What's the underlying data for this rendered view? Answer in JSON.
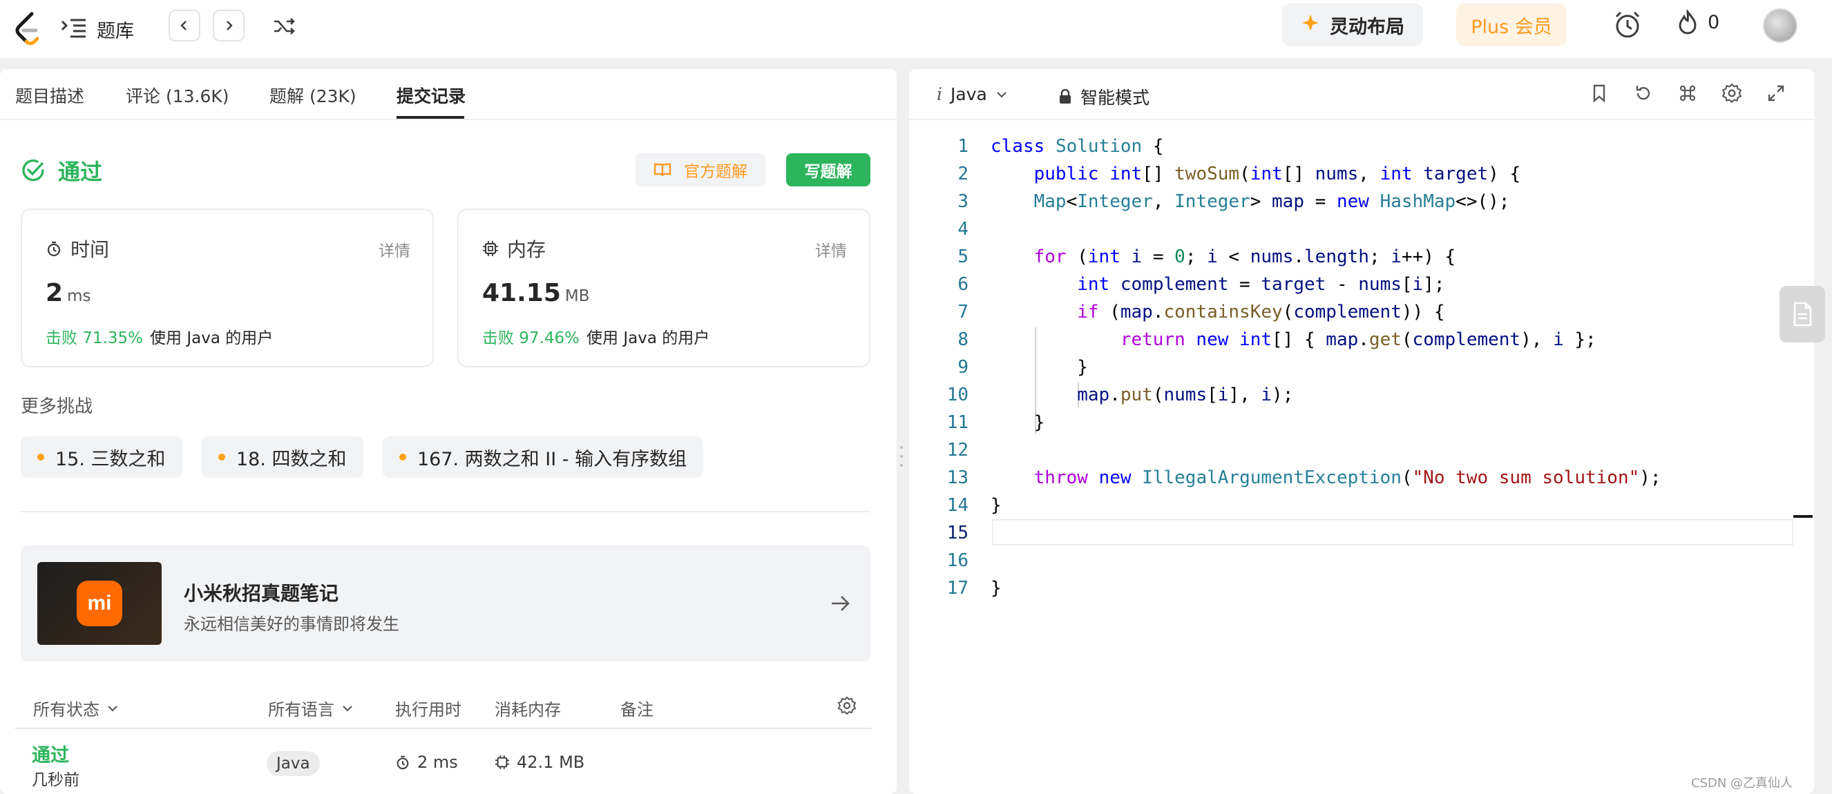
{
  "nav": {
    "title": "题库",
    "layout_button": "灵动布局",
    "plus_button": "Plus 会员",
    "streak_count": "0"
  },
  "tabs": [
    {
      "label": "题目描述"
    },
    {
      "label": "评论 (13.6K)"
    },
    {
      "label": "题解 (23K)"
    },
    {
      "label": "提交记录"
    }
  ],
  "result": {
    "status": "通过",
    "official_solution": "官方题解",
    "write_solution": "写题解",
    "time_card": {
      "title": "时间",
      "detail": "详情",
      "value": "2",
      "unit": "ms",
      "beat": "击败 71.35%",
      "beat_suffix": "使用 Java 的用户"
    },
    "memory_card": {
      "title": "内存",
      "detail": "详情",
      "value": "41.15",
      "unit": "MB",
      "beat": "击败 97.46%",
      "beat_suffix": "使用 Java 的用户"
    }
  },
  "more": {
    "title": "更多挑战",
    "items": [
      "15. 三数之和",
      "18. 四数之和",
      "167. 两数之和 II - 输入有序数组"
    ]
  },
  "promo": {
    "logo_text": "mi",
    "title": "小米秋招真题笔记",
    "subtitle": "永远相信美好的事情即将发生"
  },
  "table": {
    "headers": {
      "status": "所有状态",
      "lang": "所有语言",
      "runtime": "执行用时",
      "memory": "消耗内存",
      "note": "备注"
    },
    "rows": [
      {
        "status": "通过",
        "time": "几秒前",
        "lang": "Java",
        "runtime": "2 ms",
        "memory": "42.1 MB"
      }
    ]
  },
  "editor": {
    "language": "Java",
    "mode": "智能模式",
    "line_numbers": [
      "1",
      "2",
      "3",
      "4",
      "5",
      "6",
      "7",
      "8",
      "9",
      "10",
      "11",
      "12",
      "13",
      "14",
      "15",
      "16",
      "17"
    ],
    "code_lines": [
      "class Solution {",
      "    public int[] twoSum(int[] nums, int target) {",
      "    Map<Integer, Integer> map = new HashMap<>();",
      "",
      "    for (int i = 0; i < nums.length; i++) {",
      "        int complement = target - nums[i];",
      "        if (map.containsKey(complement)) {",
      "            return new int[] { map.get(complement), i };",
      "        }",
      "        map.put(nums[i], i);",
      "    }",
      "",
      "    throw new IllegalArgumentException(\"No two sum solution\");",
      "}",
      "",
      "",
      "}"
    ]
  },
  "watermark": "CSDN @乙真仙人",
  "colors": {
    "success": "#2db55d",
    "orange": "#ff9a1f",
    "keyword": "#0000ff",
    "control_keyword": "#af00db",
    "type": "#267f99",
    "function": "#795e26",
    "variable": "#001080",
    "number": "#098658",
    "string": "#a31515"
  }
}
